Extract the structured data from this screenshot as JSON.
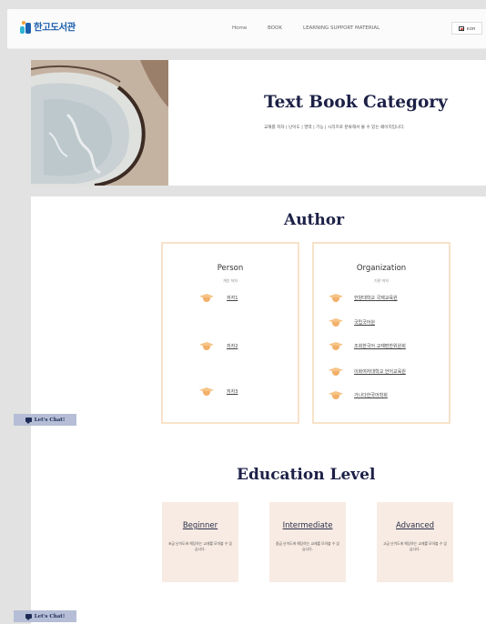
{
  "logo": {
    "text": "한고도서관"
  },
  "nav": {
    "items": [
      "Home",
      "BOOK",
      "LEARNING SUPPORT MATERIAL"
    ]
  },
  "language": {
    "label": "KOR"
  },
  "hero": {
    "title": "Text Book Category",
    "subtitle": "교재를 저자 | 난이도 | 영역 | 기능 | 시리즈로 분류해서 볼 수 있는 페이지입니다."
  },
  "author": {
    "title": "Author",
    "person": {
      "title": "Person",
      "subtitle": "개인 저자",
      "items": [
        "저자1",
        "저자2",
        "저자3"
      ]
    },
    "organization": {
      "title": "Organization",
      "subtitle": "기관 저자",
      "items": [
        "한양대학교 국제교육원",
        "국립국어원",
        "조희한국어 교재편찬위원회",
        "이화여자대학교 언어교육원",
        "가나다한국어학회"
      ]
    }
  },
  "education": {
    "title": "Education Level",
    "levels": [
      {
        "title": "Beginner",
        "desc": "초급 난이도에 해당하는 교재를 모아볼 수 있습니다."
      },
      {
        "title": "Intermediate",
        "desc": "중급 난이도에 해당하는 교재를 모아볼 수 있습니다."
      },
      {
        "title": "Advanced",
        "desc": "고급 난이도에 해당하는 교재를 모아볼 수 있습니다."
      }
    ]
  },
  "chat": {
    "label": "Let's Chat!"
  },
  "colors": {
    "brand": "#1d5fae",
    "title": "#1d2147",
    "accent": "#f7c487",
    "border": "#f8e2c9",
    "levelBg": "#f8ebe3",
    "chatBg": "#b5bed6"
  }
}
